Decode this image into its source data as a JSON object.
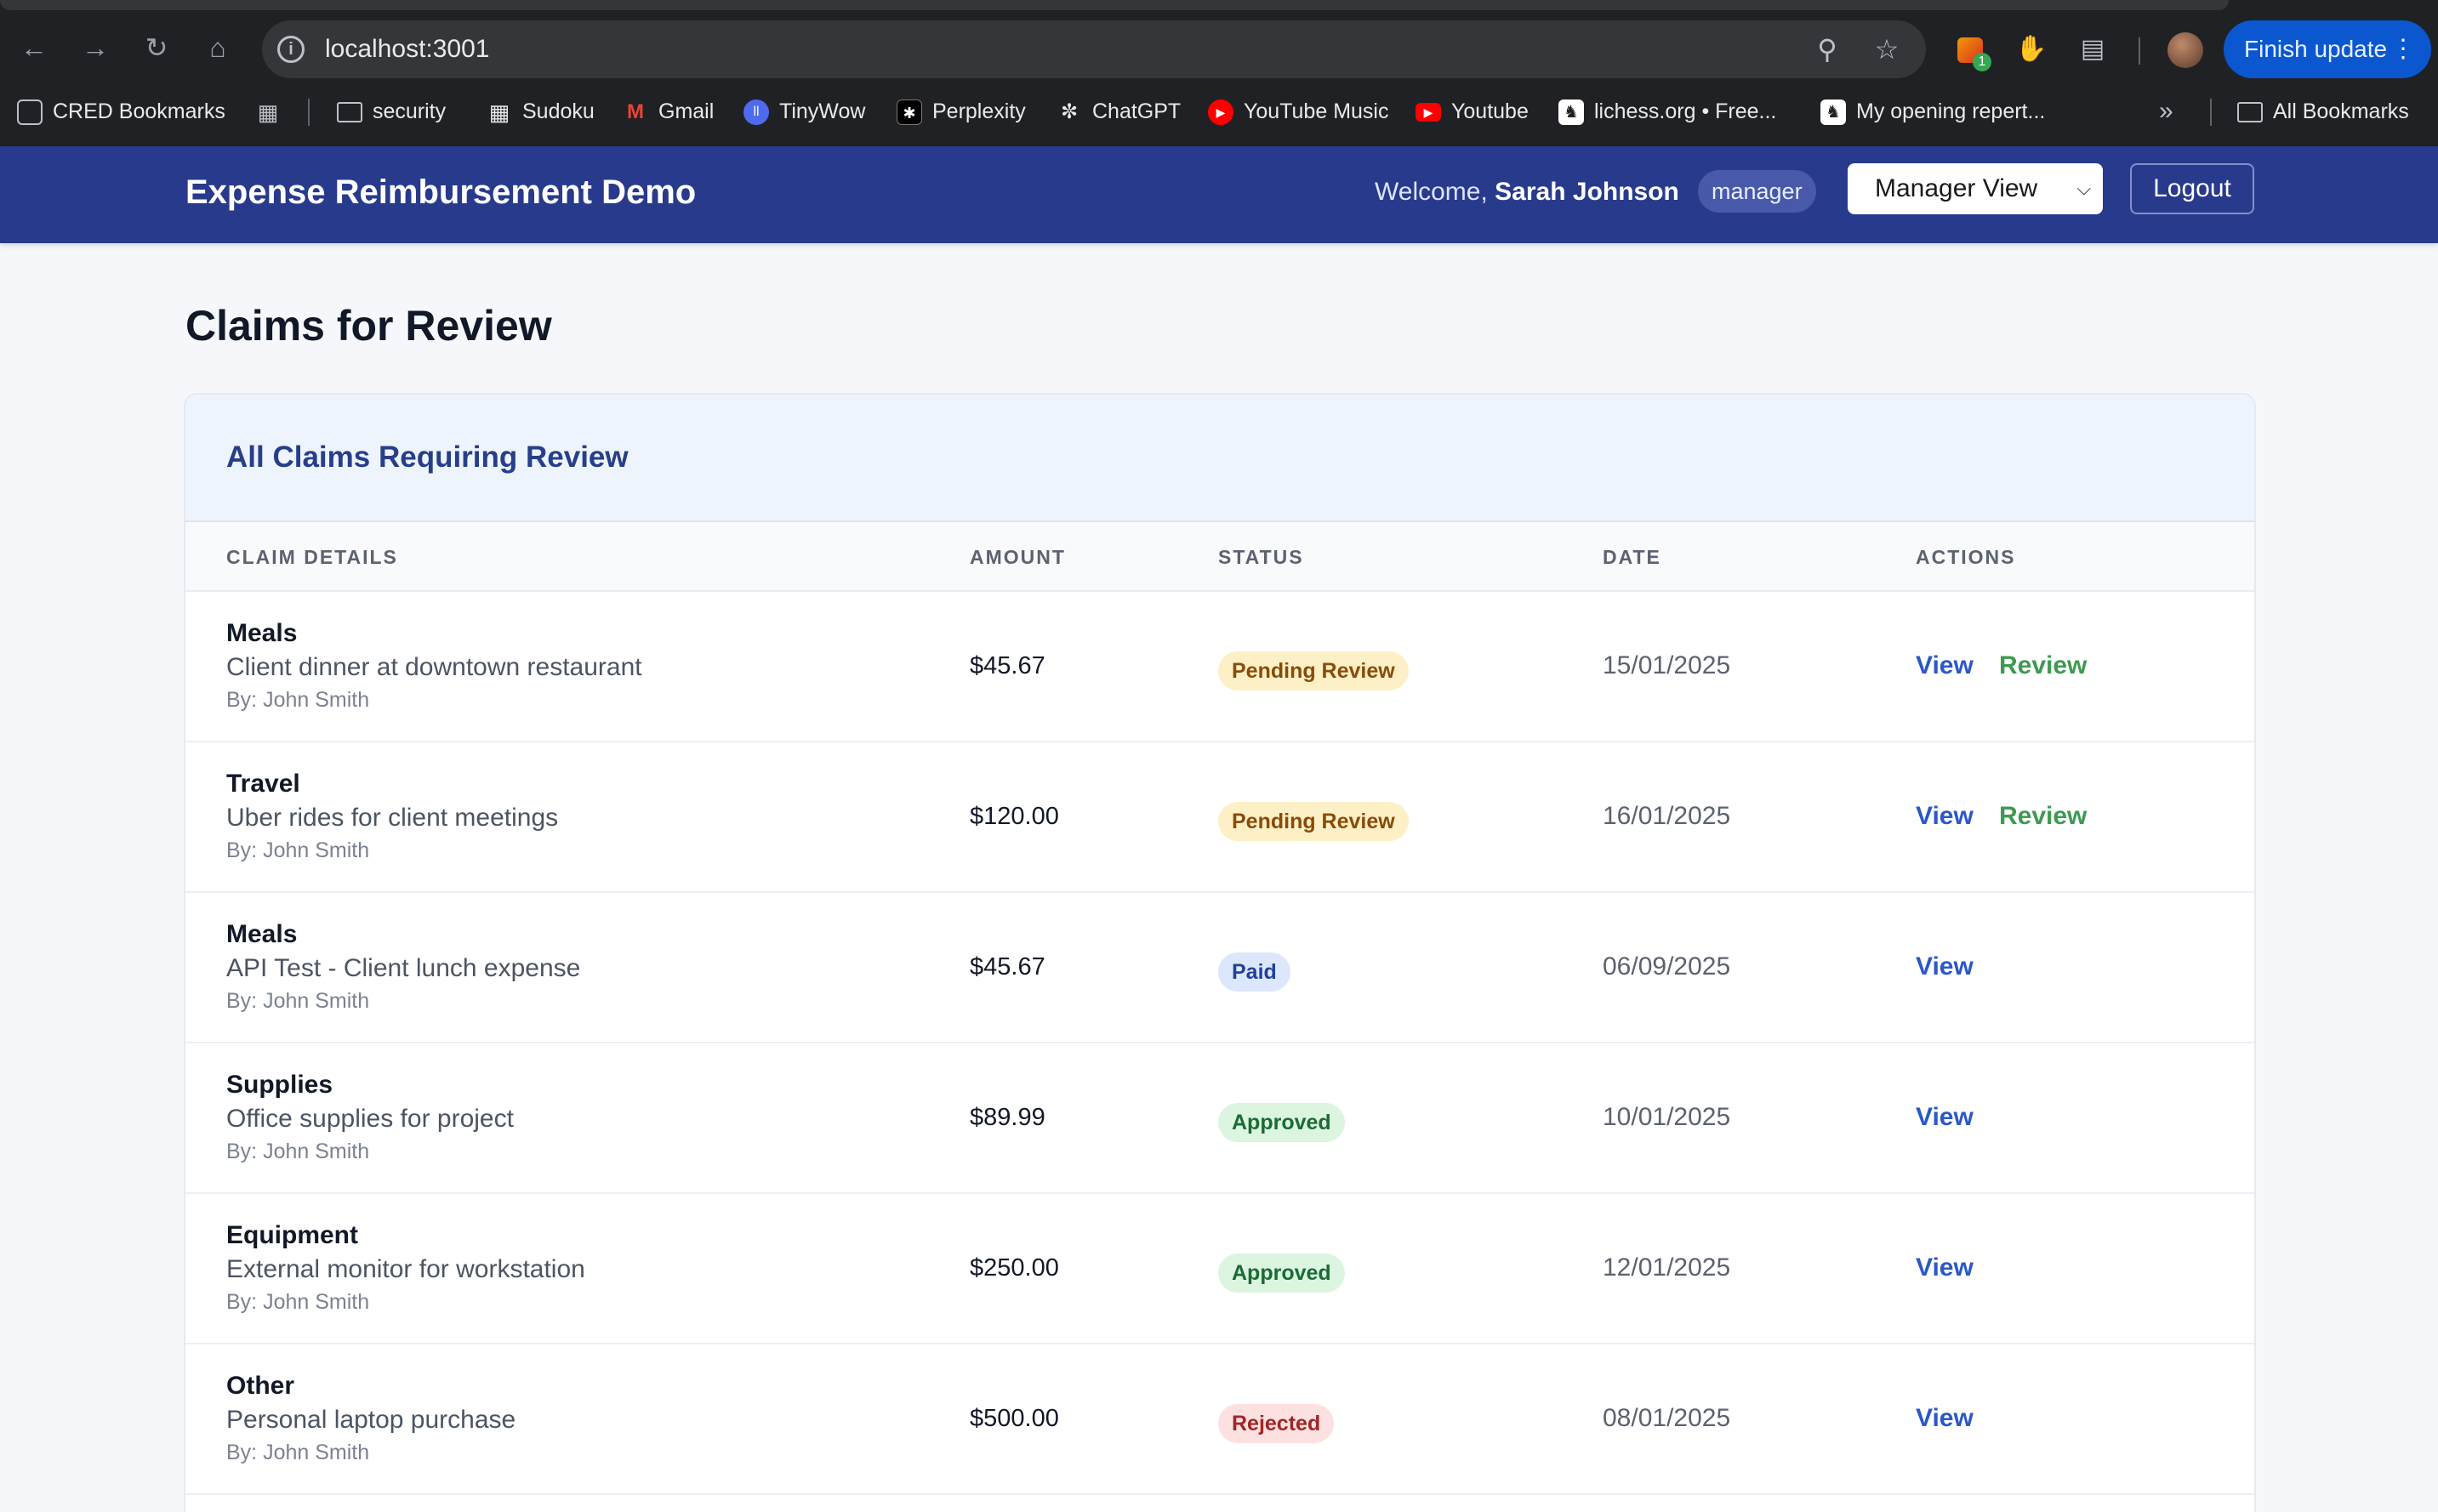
{
  "browser": {
    "url": "localhost:3001",
    "finish_update": "Finish update",
    "extension_badge": "1",
    "bookmarks": [
      {
        "label": "CRED Bookmarks",
        "icon": "bookmark-manager-icon"
      },
      {
        "label": "",
        "icon": "apps-grid-icon"
      },
      {
        "label": "security",
        "icon": "folder-icon"
      },
      {
        "label": "Sudoku",
        "icon": "sudoku-icon"
      },
      {
        "label": "Gmail",
        "icon": "gmail-icon"
      },
      {
        "label": "TinyWow",
        "icon": "tinywow-icon"
      },
      {
        "label": "Perplexity",
        "icon": "perplexity-icon"
      },
      {
        "label": "ChatGPT",
        "icon": "chatgpt-icon"
      },
      {
        "label": "YouTube Music",
        "icon": "youtube-music-icon"
      },
      {
        "label": "Youtube",
        "icon": "youtube-icon"
      },
      {
        "label": "lichess.org • Free...",
        "icon": "lichess-icon"
      },
      {
        "label": "My opening repert...",
        "icon": "lichess-icon"
      }
    ],
    "more_bookmarks": "»",
    "all_bookmarks": "All Bookmarks"
  },
  "header": {
    "app_title": "Expense Reimbursement Demo",
    "welcome_prefix": "Welcome,",
    "user_name": "Sarah Johnson",
    "role": "manager",
    "view_selected": "Manager View",
    "logout_label": "Logout"
  },
  "page": {
    "title": "Claims for Review",
    "card_title": "All Claims Requiring Review",
    "columns": [
      "CLAIM DETAILS",
      "AMOUNT",
      "STATUS",
      "DATE",
      "ACTIONS"
    ],
    "view_label": "View",
    "review_label": "Review",
    "rows": [
      {
        "category": "Meals",
        "description": "Client dinner at downtown restaurant",
        "by": "By: John Smith",
        "amount": "$45.67",
        "status": "Pending Review",
        "status_kind": "pending",
        "date": "15/01/2025",
        "reviewable": true
      },
      {
        "category": "Travel",
        "description": "Uber rides for client meetings",
        "by": "By: John Smith",
        "amount": "$120.00",
        "status": "Pending Review",
        "status_kind": "pending",
        "date": "16/01/2025",
        "reviewable": true
      },
      {
        "category": "Meals",
        "description": "API Test - Client lunch expense",
        "by": "By: John Smith",
        "amount": "$45.67",
        "status": "Paid",
        "status_kind": "paid",
        "date": "06/09/2025",
        "reviewable": false
      },
      {
        "category": "Supplies",
        "description": "Office supplies for project",
        "by": "By: John Smith",
        "amount": "$89.99",
        "status": "Approved",
        "status_kind": "approved",
        "date": "10/01/2025",
        "reviewable": false
      },
      {
        "category": "Equipment",
        "description": "External monitor for workstation",
        "by": "By: John Smith",
        "amount": "$250.00",
        "status": "Approved",
        "status_kind": "approved",
        "date": "12/01/2025",
        "reviewable": false
      },
      {
        "category": "Other",
        "description": "Personal laptop purchase",
        "by": "By: John Smith",
        "amount": "$500.00",
        "status": "Rejected",
        "status_kind": "rejected",
        "date": "08/01/2025",
        "reviewable": false
      }
    ]
  },
  "colors": {
    "header_bg": "#283a8c",
    "pending": "#fdf0c7",
    "paid": "#dde7fb",
    "approved": "#dcf5e1",
    "rejected": "#fde1e1",
    "view_link": "#2b58c7",
    "review_link": "#3e9a52"
  }
}
